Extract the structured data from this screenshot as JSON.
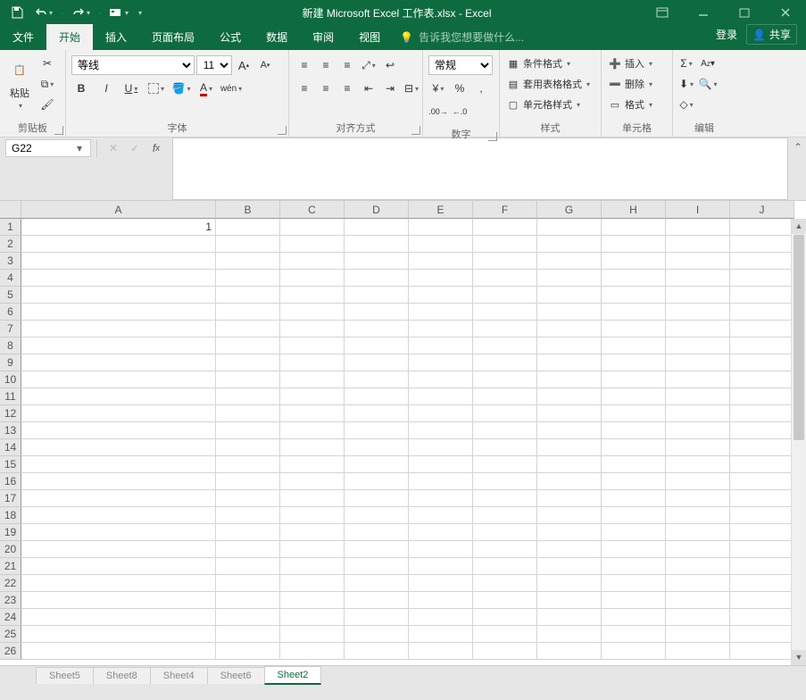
{
  "title": "新建 Microsoft Excel 工作表.xlsx - Excel",
  "menu": {
    "file": "文件",
    "home": "开始",
    "insert": "插入",
    "layout": "页面布局",
    "formula": "公式",
    "data": "数据",
    "review": "审阅",
    "view": "视图",
    "tellme": "告诉我您想要做什么...",
    "login": "登录",
    "share": "共享"
  },
  "ribbon": {
    "clipboard": {
      "label": "剪贴板",
      "paste": "粘贴"
    },
    "font": {
      "label": "字体",
      "name": "等线",
      "size": "11",
      "bold": "B",
      "italic": "I",
      "underline": "U",
      "wen": "wén"
    },
    "align": {
      "label": "对齐方式"
    },
    "number": {
      "label": "数字",
      "format": "常规"
    },
    "styles": {
      "label": "样式",
      "condfmt": "条件格式",
      "tablefmt": "套用表格格式",
      "cellstyle": "单元格样式"
    },
    "cells": {
      "label": "单元格",
      "insert": "插入",
      "delete": "删除",
      "format": "格式"
    },
    "editing": {
      "label": "编辑"
    }
  },
  "namebox": "G22",
  "columns": [
    "A",
    "B",
    "C",
    "D",
    "E",
    "F",
    "G",
    "H",
    "I",
    "J"
  ],
  "rows": 26,
  "cell_A1": "1",
  "sheets": [
    "Sheet5",
    "Sheet8",
    "Sheet4",
    "Sheet6",
    "Sheet2"
  ],
  "active_sheet": 4
}
